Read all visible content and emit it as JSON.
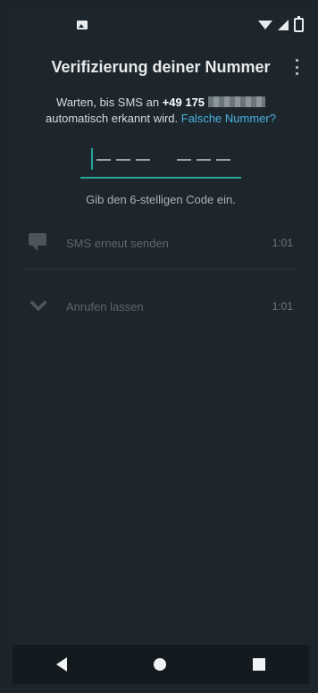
{
  "app": {
    "title": "Verifizierung deiner Nummer",
    "intro_prefix": "Warten, bis SMS an",
    "phone_number": "+49 175",
    "intro_suffix": "automatisch erkannt wird.",
    "wrong_number_link": "Falsche Nummer?",
    "code_hint": "Gib den 6-stelligen Code ein.",
    "code_length": 6
  },
  "options": [
    {
      "label": "SMS erneut senden",
      "time": "1:01",
      "icon": "sms-icon"
    },
    {
      "label": "Anrufen lassen",
      "time": "1:01",
      "icon": "phone-icon"
    }
  ],
  "colors": {
    "accent": "#2aa59a",
    "link": "#4ab3e2",
    "background": "#1c262c"
  },
  "icons": {
    "status_left": "image-icon",
    "wifi": "wifi-icon",
    "signal": "signal-icon",
    "battery": "battery-icon",
    "more": "more-vert-icon",
    "nav_back": "back-icon",
    "nav_home": "home-icon",
    "nav_recent": "recents-icon"
  }
}
